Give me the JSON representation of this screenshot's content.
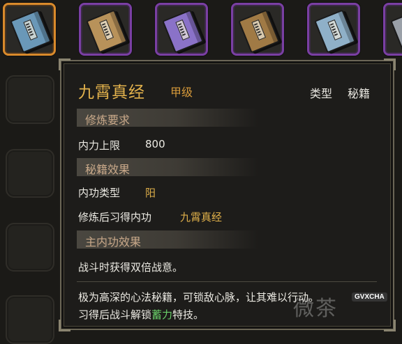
{
  "item": {
    "name": "九霄真经",
    "grade": "甲级",
    "type_label": "类型",
    "type_value": "秘籍"
  },
  "sections": {
    "requirements": {
      "title": "修炼要求",
      "label": "内力上限",
      "value": "800"
    },
    "effects": {
      "title": "秘籍效果",
      "row1_label": "内功类型",
      "row1_value": "阳",
      "row2_label": "修炼后习得内功",
      "row2_value": "九霄真经"
    },
    "main_effect": {
      "title": "主内功效果",
      "text": "战斗时获得双倍战意。"
    }
  },
  "description": {
    "line1": "极为高深的心法秘籍，可锁敌心脉，让其难以行动。",
    "line2_prefix": "习得后战斗解锁",
    "line2_highlight": "蓄力",
    "line2_suffix": "特技。"
  },
  "watermark": {
    "text": "微茶",
    "badge": "GVXCHA"
  },
  "colors": {
    "accent_gold": "#e3b24c",
    "rarity_purple": "#7a3fa3",
    "selected_orange": "#d98a2b",
    "highlight_green": "#6ad06a"
  },
  "inventory_books": [
    {
      "icon": "book-blue-icon",
      "color": "#6a98b8",
      "selected": true
    },
    {
      "icon": "book-tan-icon",
      "color": "#b8925a",
      "selected": false
    },
    {
      "icon": "book-purple-icon",
      "color": "#8a72c8",
      "selected": false
    },
    {
      "icon": "book-brown-icon",
      "color": "#a07a45",
      "selected": false
    },
    {
      "icon": "book-lightblue-icon",
      "color": "#8fb0c8",
      "selected": false
    },
    {
      "icon": "book-partial-icon",
      "color": "#9aa0a8",
      "selected": false
    }
  ]
}
